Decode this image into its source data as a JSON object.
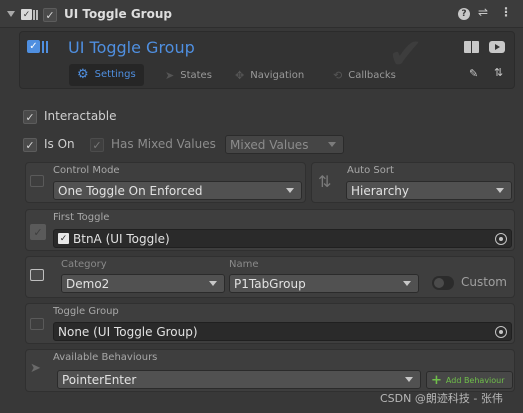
{
  "header": {
    "title": "UI Toggle Group",
    "icons": [
      "help-icon",
      "preset-icon",
      "kebab-menu-icon"
    ]
  },
  "banner": {
    "title": "UI Toggle Group",
    "tabs": [
      {
        "label": "Settings",
        "icon": "gear-icon",
        "active": true
      },
      {
        "label": "States",
        "icon": "cursor-icon",
        "active": false
      },
      {
        "label": "Navigation",
        "icon": "navigation-icon",
        "active": false
      },
      {
        "label": "Callbacks",
        "icon": "callbacks-icon",
        "active": false
      }
    ]
  },
  "interactable": {
    "label": "Interactable",
    "checked": true
  },
  "is_on": {
    "label": "Is On",
    "checked": true
  },
  "mixed": {
    "label": "Has Mixed Values",
    "checked": true,
    "dropdown": "Mixed Values"
  },
  "control_mode": {
    "label": "Control Mode",
    "value": "One Toggle On Enforced"
  },
  "auto_sort": {
    "label": "Auto Sort",
    "value": "Hierarchy"
  },
  "first_toggle": {
    "label": "First Toggle",
    "value": "BtnA (UI Toggle)"
  },
  "category": {
    "label": "Category",
    "value": "Demo2"
  },
  "name": {
    "label": "Name",
    "value": "P1TabGroup"
  },
  "custom": {
    "label": "Custom"
  },
  "toggle_group": {
    "label": "Toggle Group",
    "value": "None (UI Toggle Group)"
  },
  "behaviours": {
    "label": "Available Behaviours",
    "value": "PointerEnter",
    "add_label": "Add Behaviour"
  },
  "watermark": "CSDN @朗迹科技 - 张伟",
  "colors": {
    "accent": "#4f8fe0",
    "add_green": "#6fbf4a",
    "panel": "#3e3e3e",
    "background": "#383838"
  }
}
